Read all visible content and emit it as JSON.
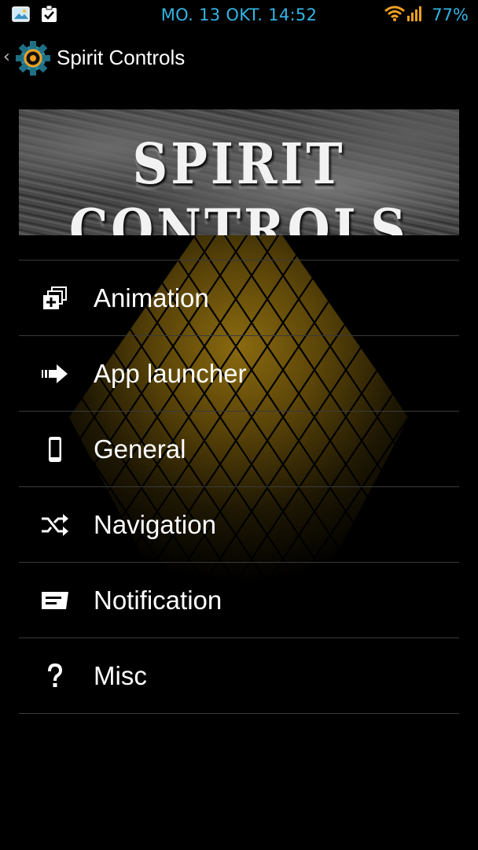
{
  "status_bar": {
    "datetime": "MO. 13 OKT. 14:52",
    "battery": "77%"
  },
  "action_bar": {
    "back_glyph": "‹",
    "title": "Spirit Controls"
  },
  "banner": {
    "title": "SPIRIT CONTROLS"
  },
  "menu": {
    "items": [
      {
        "label": "Animation",
        "icon": "layers-add-icon"
      },
      {
        "label": "App launcher",
        "icon": "arrow-right-icon"
      },
      {
        "label": "General",
        "icon": "phone-icon"
      },
      {
        "label": "Navigation",
        "icon": "shuffle-icon"
      },
      {
        "label": "Notification",
        "icon": "message-icon"
      },
      {
        "label": "Misc",
        "icon": "question-icon"
      }
    ]
  },
  "colors": {
    "accent": "#33b5e5",
    "glow": "#8a6a10",
    "divider": "#3a3a3a"
  }
}
